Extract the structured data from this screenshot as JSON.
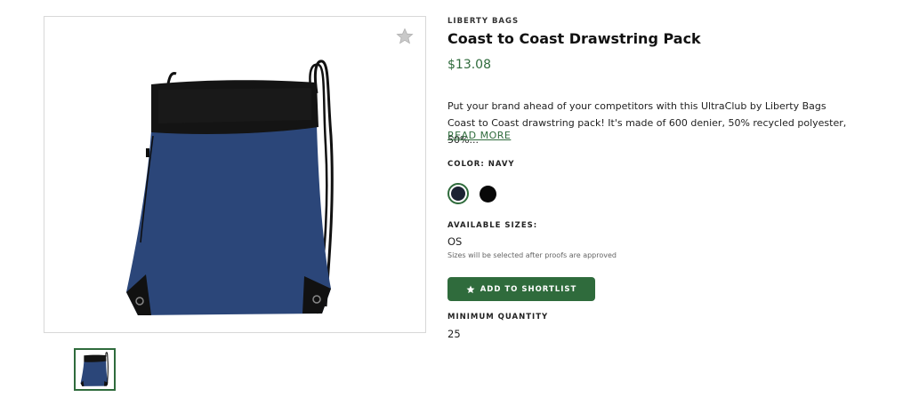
{
  "product": {
    "brand": "LIBERTY BAGS",
    "title": "Coast to Coast Drawstring Pack",
    "price": "$13.08",
    "description": "Put your brand ahead of your competitors with this UltraClub by Liberty Bags Coast to Coast drawstring pack! It's made of 600 denier, 50% recycled polyester, 50%...",
    "read_more": "READ MORE"
  },
  "color": {
    "label": "COLOR: NAVY",
    "swatches": [
      {
        "name": "Navy",
        "hex": "#1c2233",
        "selected": true
      },
      {
        "name": "Black",
        "hex": "#080808",
        "selected": false
      }
    ]
  },
  "sizes": {
    "label": "AVAILABLE SIZES:",
    "value": "OS",
    "note": "Sizes will be selected after proofs are approved"
  },
  "shortlist_button": {
    "label": "ADD TO SHORTLIST",
    "icon": "star-icon"
  },
  "minimum_quantity": {
    "label": "MINIMUM QUANTITY",
    "value": "25"
  },
  "icons": {
    "favorite": "star-icon"
  },
  "colors": {
    "accent": "#2f6b3c",
    "bag_body": "#2b4679",
    "bag_trim": "#111111"
  }
}
